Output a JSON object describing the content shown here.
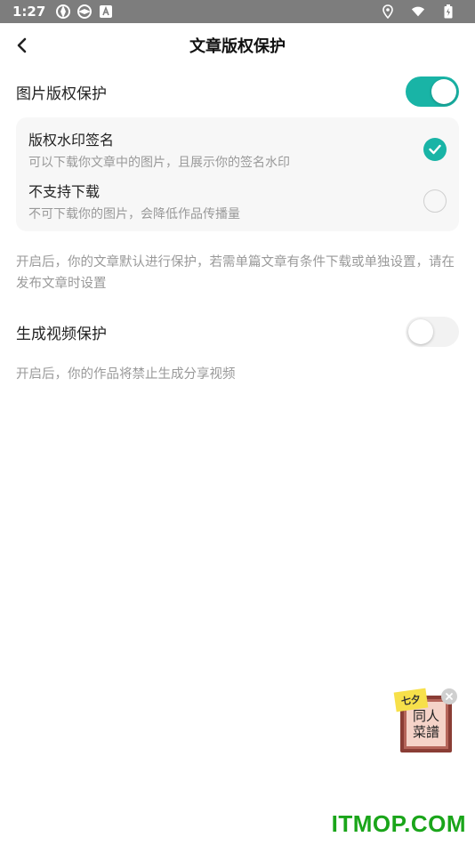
{
  "status_bar": {
    "time": "1:27",
    "icons_left": [
      "aperture-icon",
      "aperture-icon",
      "font-icon"
    ],
    "icons_right": [
      "location-icon",
      "wifi-icon",
      "battery-icon"
    ]
  },
  "nav": {
    "back_icon": "chevron-left-icon",
    "title": "文章版权保护"
  },
  "image_copyright": {
    "label": "图片版权保护",
    "toggle_on": true,
    "options": [
      {
        "title": "版权水印签名",
        "description": "可以下载你文章中的图片，且展示你的签名水印",
        "selected": true
      },
      {
        "title": "不支持下载",
        "description": "不可下载你的图片，会降低作品传播量",
        "selected": false
      }
    ],
    "note": "开启后，你的文章默认进行保护，若需单篇文章有条件下载或单独设置，请在发布文章时设置"
  },
  "video_protection": {
    "label": "生成视频保护",
    "toggle_on": false,
    "note": "开启后，你的作品将禁止生成分享视频"
  },
  "float_badge": {
    "tag_text": "七夕",
    "line1": "同人",
    "line2": "菜譜"
  },
  "watermark": "ITMOP.COM",
  "colors": {
    "accent": "#19b4a6",
    "status_bar": "#7d7d7d",
    "watermark": "#1aa51a"
  }
}
